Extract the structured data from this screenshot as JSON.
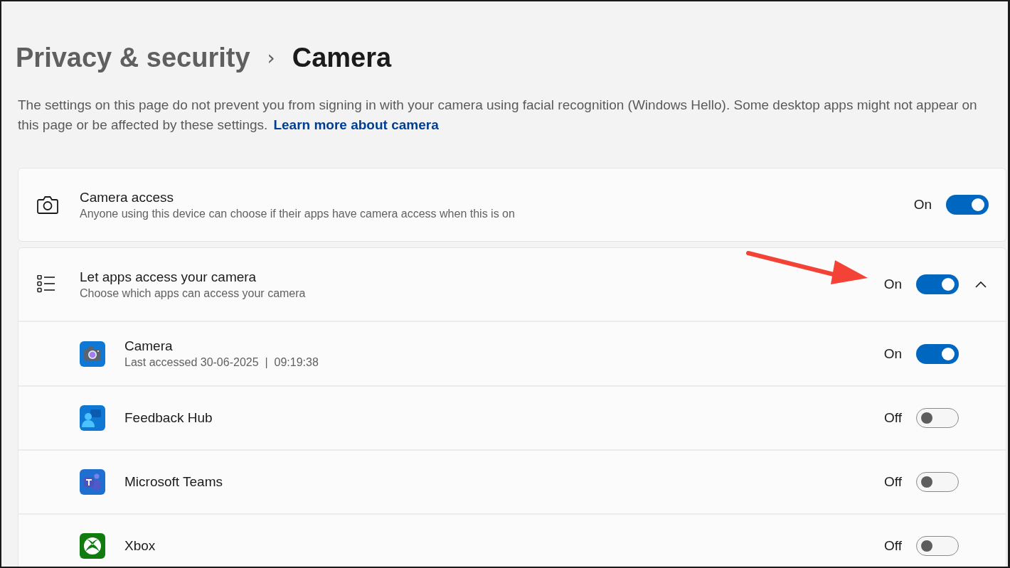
{
  "breadcrumb": {
    "parent": "Privacy & security",
    "separator": "›",
    "current": "Camera"
  },
  "description": {
    "text": "The settings on this page do not prevent you from signing in with your camera using facial recognition (Windows Hello). Some desktop apps might not appear on this page or be affected by these settings.",
    "link": "Learn more about camera"
  },
  "camera_access": {
    "title": "Camera access",
    "subtitle": "Anyone using this device can choose if their apps have camera access when this is on",
    "state_label": "On",
    "on": true
  },
  "apps_access": {
    "title": "Let apps access your camera",
    "subtitle": "Choose which apps can access your camera",
    "state_label": "On",
    "on": true,
    "expanded": true,
    "apps": [
      {
        "kind": "camera",
        "name": "Camera",
        "detail": "Last accessed 30-06-2025  |  09:19:38",
        "state_label": "On",
        "on": true
      },
      {
        "kind": "feedback",
        "name": "Feedback Hub",
        "state_label": "Off",
        "on": false
      },
      {
        "kind": "teams",
        "name": "Microsoft Teams",
        "state_label": "Off",
        "on": false
      },
      {
        "kind": "xbox",
        "name": "Xbox",
        "state_label": "Off",
        "on": false
      }
    ]
  }
}
